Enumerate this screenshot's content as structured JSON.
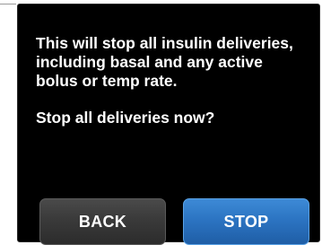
{
  "dialog": {
    "message_lines": [
      "This will stop all insulin deliveries,",
      "including basal and any active",
      "bolus or temp rate."
    ],
    "question": "Stop all deliveries now?"
  },
  "buttons": {
    "back_label": "BACK",
    "stop_label": "STOP"
  },
  "colors": {
    "screen_background": "#000000",
    "back_button": "#3a3a3a",
    "stop_button": "#2c74c2",
    "text": "#ffffff"
  }
}
